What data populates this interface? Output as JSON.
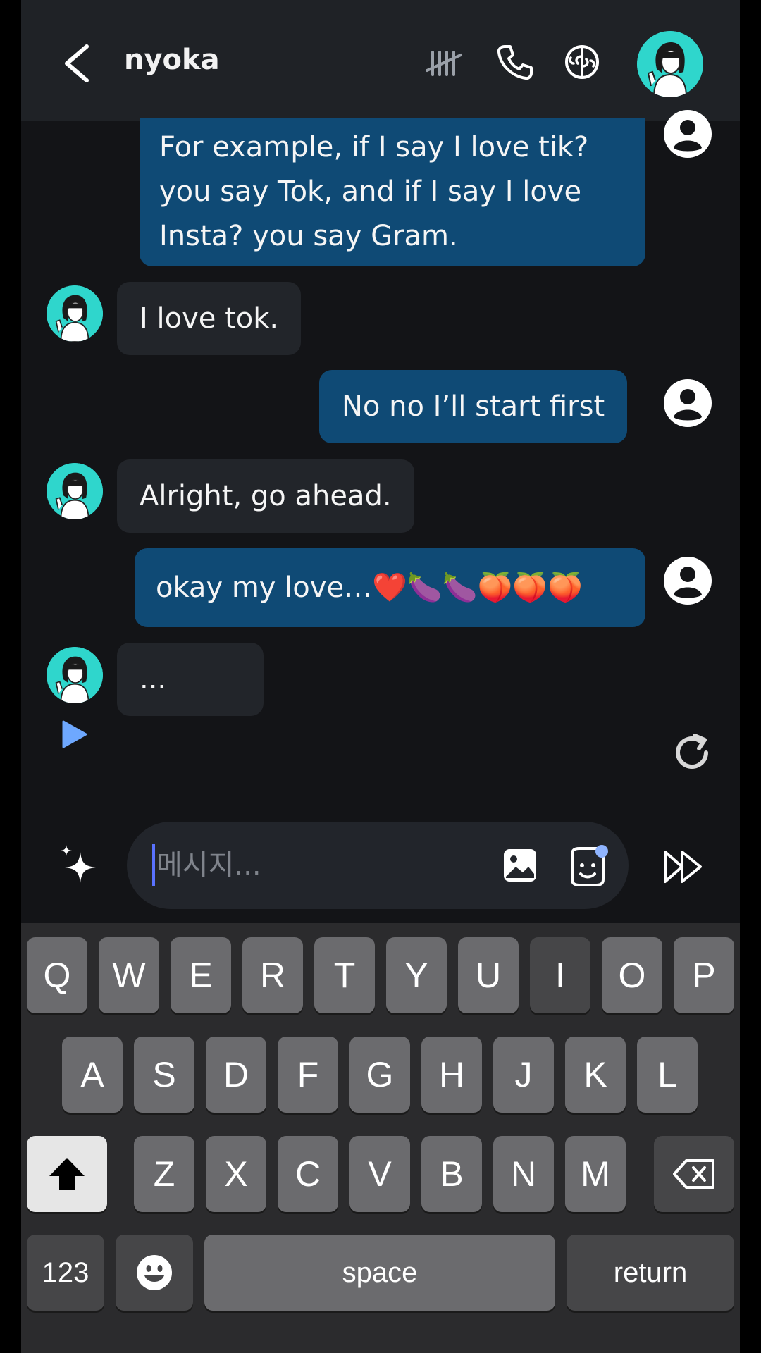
{
  "header": {
    "back_icon": "chevron-left-icon",
    "contact_name": "nyoka",
    "icons": [
      "tally-icon",
      "phone-icon",
      "brain-icon"
    ],
    "avatar": "nyoka-avatar"
  },
  "messages": [
    {
      "from": "user",
      "text": [
        "For example, if I say I love tik?",
        "you say Tok, and if I say I love",
        "Insta? you say Gram."
      ]
    },
    {
      "from": "bot",
      "text": "I love tok."
    },
    {
      "from": "user",
      "text": "No no I’ll start first"
    },
    {
      "from": "bot",
      "text": "Alright, go ahead."
    },
    {
      "from": "user",
      "text": "okay my love…❤️🍆🍆🍑🍑🍑"
    },
    {
      "from": "bot",
      "text": "..."
    }
  ],
  "composer": {
    "placeholder": "메시지...",
    "value": ""
  },
  "keyboard": {
    "row1": [
      "Q",
      "W",
      "E",
      "R",
      "T",
      "Y",
      "U",
      "I",
      "O",
      "P"
    ],
    "row2": [
      "A",
      "S",
      "D",
      "F",
      "G",
      "H",
      "J",
      "K",
      "L"
    ],
    "row3": [
      "Z",
      "X",
      "C",
      "V",
      "B",
      "N",
      "M"
    ],
    "numbers_label": "123",
    "space_label": "space",
    "return_label": "return"
  },
  "colors": {
    "background": "#131417",
    "header": "#1f2226",
    "user_bubble": "#0f4a75",
    "bot_bubble": "#22252a",
    "avatar_accent": "#2fd6cc"
  }
}
